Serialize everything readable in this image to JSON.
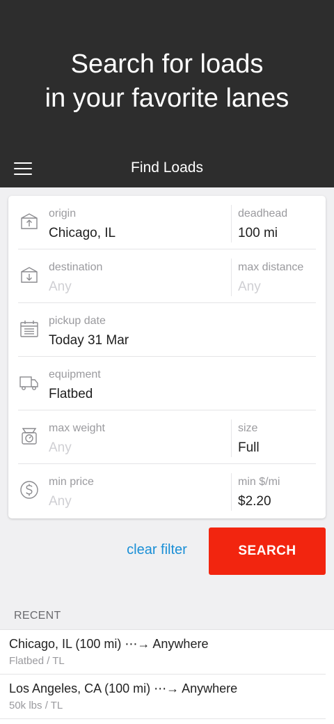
{
  "hero": {
    "line1": "Search for loads",
    "line2": "in your favorite lanes"
  },
  "navbar": {
    "title": "Find Loads",
    "menu_icon": "hamburger-menu-icon"
  },
  "form": {
    "origin": {
      "label": "origin",
      "value": "Chicago, IL",
      "icon": "box-up-arrow-icon"
    },
    "deadhead": {
      "label": "deadhead",
      "value": "100 mi"
    },
    "destination": {
      "label": "destination",
      "placeholder": "Any",
      "icon": "box-down-arrow-icon"
    },
    "max_distance": {
      "label": "max distance",
      "placeholder": "Any"
    },
    "pickup_date": {
      "label": "pickup date",
      "value": "Today 31 Mar",
      "icon": "calendar-icon"
    },
    "equipment": {
      "label": "equipment",
      "value": "Flatbed",
      "icon": "truck-icon"
    },
    "max_weight": {
      "label": "max weight",
      "placeholder": "Any",
      "icon": "scale-icon"
    },
    "size": {
      "label": "size",
      "value": "Full"
    },
    "min_price": {
      "label": "min price",
      "placeholder": "Any",
      "icon": "dollar-circle-icon"
    },
    "min_rate": {
      "label": "min $/mi",
      "value": "$2.20"
    }
  },
  "actions": {
    "clear_label": "clear filter",
    "search_label": "SEARCH",
    "search_color": "#f2250f",
    "link_color": "#1a8fd6"
  },
  "recent": {
    "title": "RECENT",
    "items": [
      {
        "route": "Chicago, IL (100 mi) ⋯→ Anywhere",
        "details": "Flatbed / TL"
      },
      {
        "route": "Los Angeles, CA (100 mi) ⋯→ Anywhere",
        "details": "50k lbs / TL"
      }
    ]
  }
}
